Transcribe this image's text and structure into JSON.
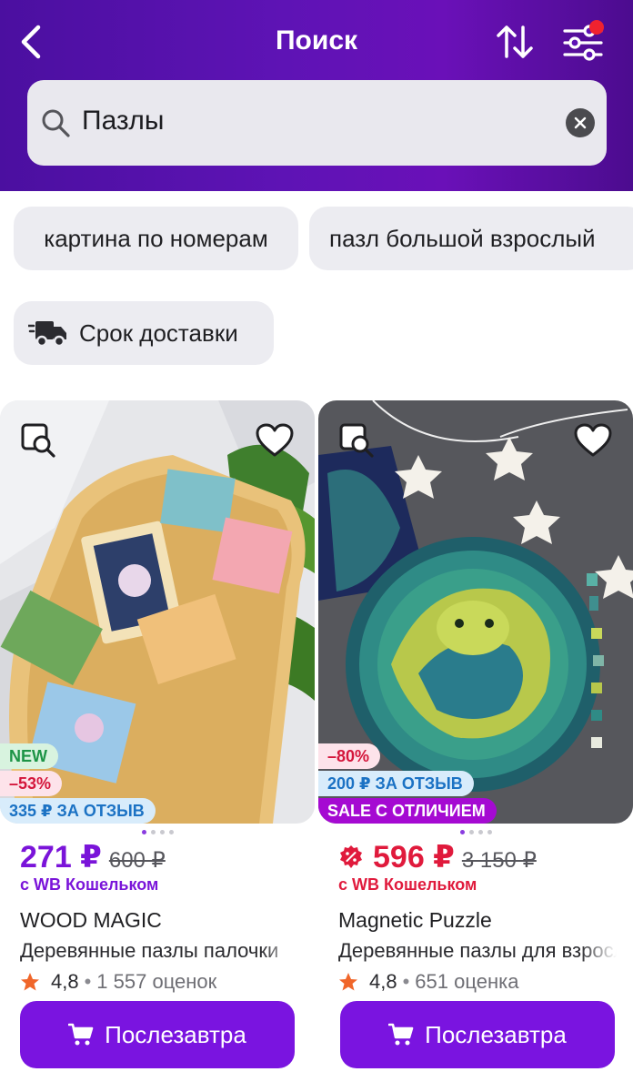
{
  "header": {
    "title": "Поиск",
    "search_value": "Пазлы"
  },
  "suggestions": [
    "картина по номерам",
    "пазл большой взрослый"
  ],
  "delivery_chip": "Срок доставки",
  "products": [
    {
      "badges": [
        "NEW",
        "–53%",
        "335 ₽ ЗА ОТЗЫВ"
      ],
      "price": "271 ₽",
      "old_price": "600 ₽",
      "wallet": "с WB Кошельком",
      "brand": "WOOD MAGIC",
      "name": "Деревянные пазлы палочки",
      "rating": "4,8",
      "reviews": "1 557 оценок",
      "button": "Послезавтра",
      "photo_dots": 4,
      "photo_active": 0
    },
    {
      "badges": [
        "–80%",
        "200 ₽ ЗА ОТЗЫВ",
        "SALE С ОТЛИЧИЕМ"
      ],
      "price": "596 ₽",
      "old_price": "3 150 ₽",
      "wallet": "с WB Кошельком",
      "brand": "Magnetic Puzzle",
      "name": "Деревянные пазлы для взрослых",
      "rating": "4,8",
      "reviews": "651 оценка",
      "button": "Послезавтра",
      "photo_dots": 4,
      "photo_active": 0
    }
  ],
  "colors": {
    "header": "#5e13b5",
    "accent": "#7a14e0",
    "sale_price": "#e01a3c",
    "filter_indicator": "#f0222f"
  }
}
